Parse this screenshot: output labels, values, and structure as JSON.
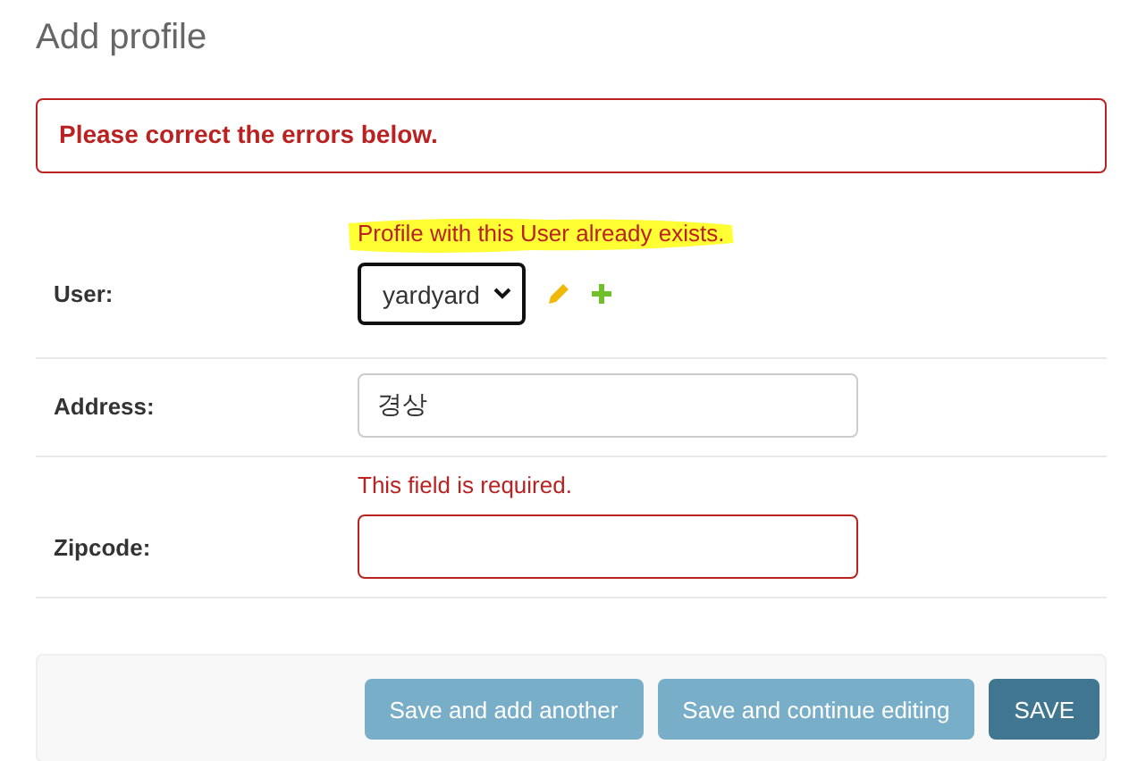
{
  "title": "Add profile",
  "error_note": "Please correct the errors below.",
  "fields": [
    {
      "label": "User:",
      "kind": "select",
      "value": "yardyard",
      "errors": [
        "Profile with this User already exists."
      ],
      "highlighted": true,
      "focused": true,
      "invalid": false
    },
    {
      "label": "Address:",
      "kind": "text",
      "value": "경상",
      "highlighted": false,
      "focused": false,
      "invalid": false
    },
    {
      "label": "Zipcode:",
      "kind": "text",
      "errors": [
        "This field is required."
      ],
      "highlighted": false,
      "focused": false,
      "invalid": true
    }
  ],
  "buttons": [
    {
      "label": "Save and add another",
      "kind": "secondary"
    },
    {
      "label": "Save and continue editing",
      "kind": "secondary"
    },
    {
      "label": "SAVE",
      "kind": "default"
    }
  ]
}
